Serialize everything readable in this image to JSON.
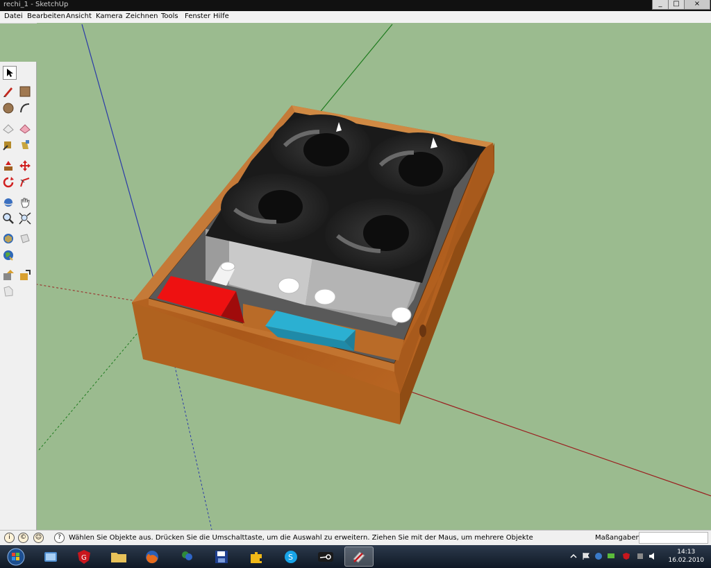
{
  "window": {
    "title": "rechi_1 - SketchUp",
    "minimize": "_",
    "maximize": "□",
    "close": "×"
  },
  "menu": [
    "Datei",
    "Bearbeiten",
    "Ansicht",
    "Kamera",
    "Zeichnen",
    "Tools",
    "Fenster",
    "Hilfe"
  ],
  "toolbar": {
    "tools": [
      "select-tool-icon",
      "pencil-tool-icon",
      "rectangle-tool-icon",
      "circle-tool-icon",
      "arc-tool-icon",
      "eraser-tool-icon",
      "paint-bucket-tool-icon",
      "tape-measure-tool-icon",
      "paint-bucket-alt-icon",
      "push-pull-tool-icon",
      "move-tool-icon",
      "rotate-tool-icon",
      "follow-me-tool-icon",
      "orbit-tool-icon",
      "pan-tool-icon",
      "zoom-tool-icon",
      "zoom-extents-tool-icon",
      "3d-warehouse-icon",
      "components-icon",
      "google-earth-icon",
      "add-location-icon",
      "get-model-icon",
      "share-model-icon",
      "section-plane-icon"
    ]
  },
  "statusbar": {
    "icons": [
      "geo-location-icon",
      "credits-icon",
      "user-icon",
      "help-icon"
    ],
    "text": "Wählen Sie Objekte aus. Drücken Sie die Umschalttaste, um die Auswahl zu erweitern. Ziehen Sie mit der Maus, um mehrere Objekte",
    "measure_label": "Maßangaben",
    "measure_value": ""
  },
  "taskbar": {
    "items": [
      "start-button-icon",
      "windows-explorer-icon",
      "antivirus-icon",
      "folder-icon",
      "firefox-icon",
      "messenger-icon",
      "save-disk-icon",
      "puzzle-app-icon",
      "skype-icon",
      "steam-icon",
      "sketchup-icon"
    ],
    "time": "14:13",
    "date": "16.02.2010"
  },
  "colors": {
    "viewport_bg": "#9bbb8f",
    "wood": "#b3621f",
    "fan": "#1e1e1e",
    "block_red": "#ee1111",
    "block_cyan": "#2bb0d2"
  }
}
